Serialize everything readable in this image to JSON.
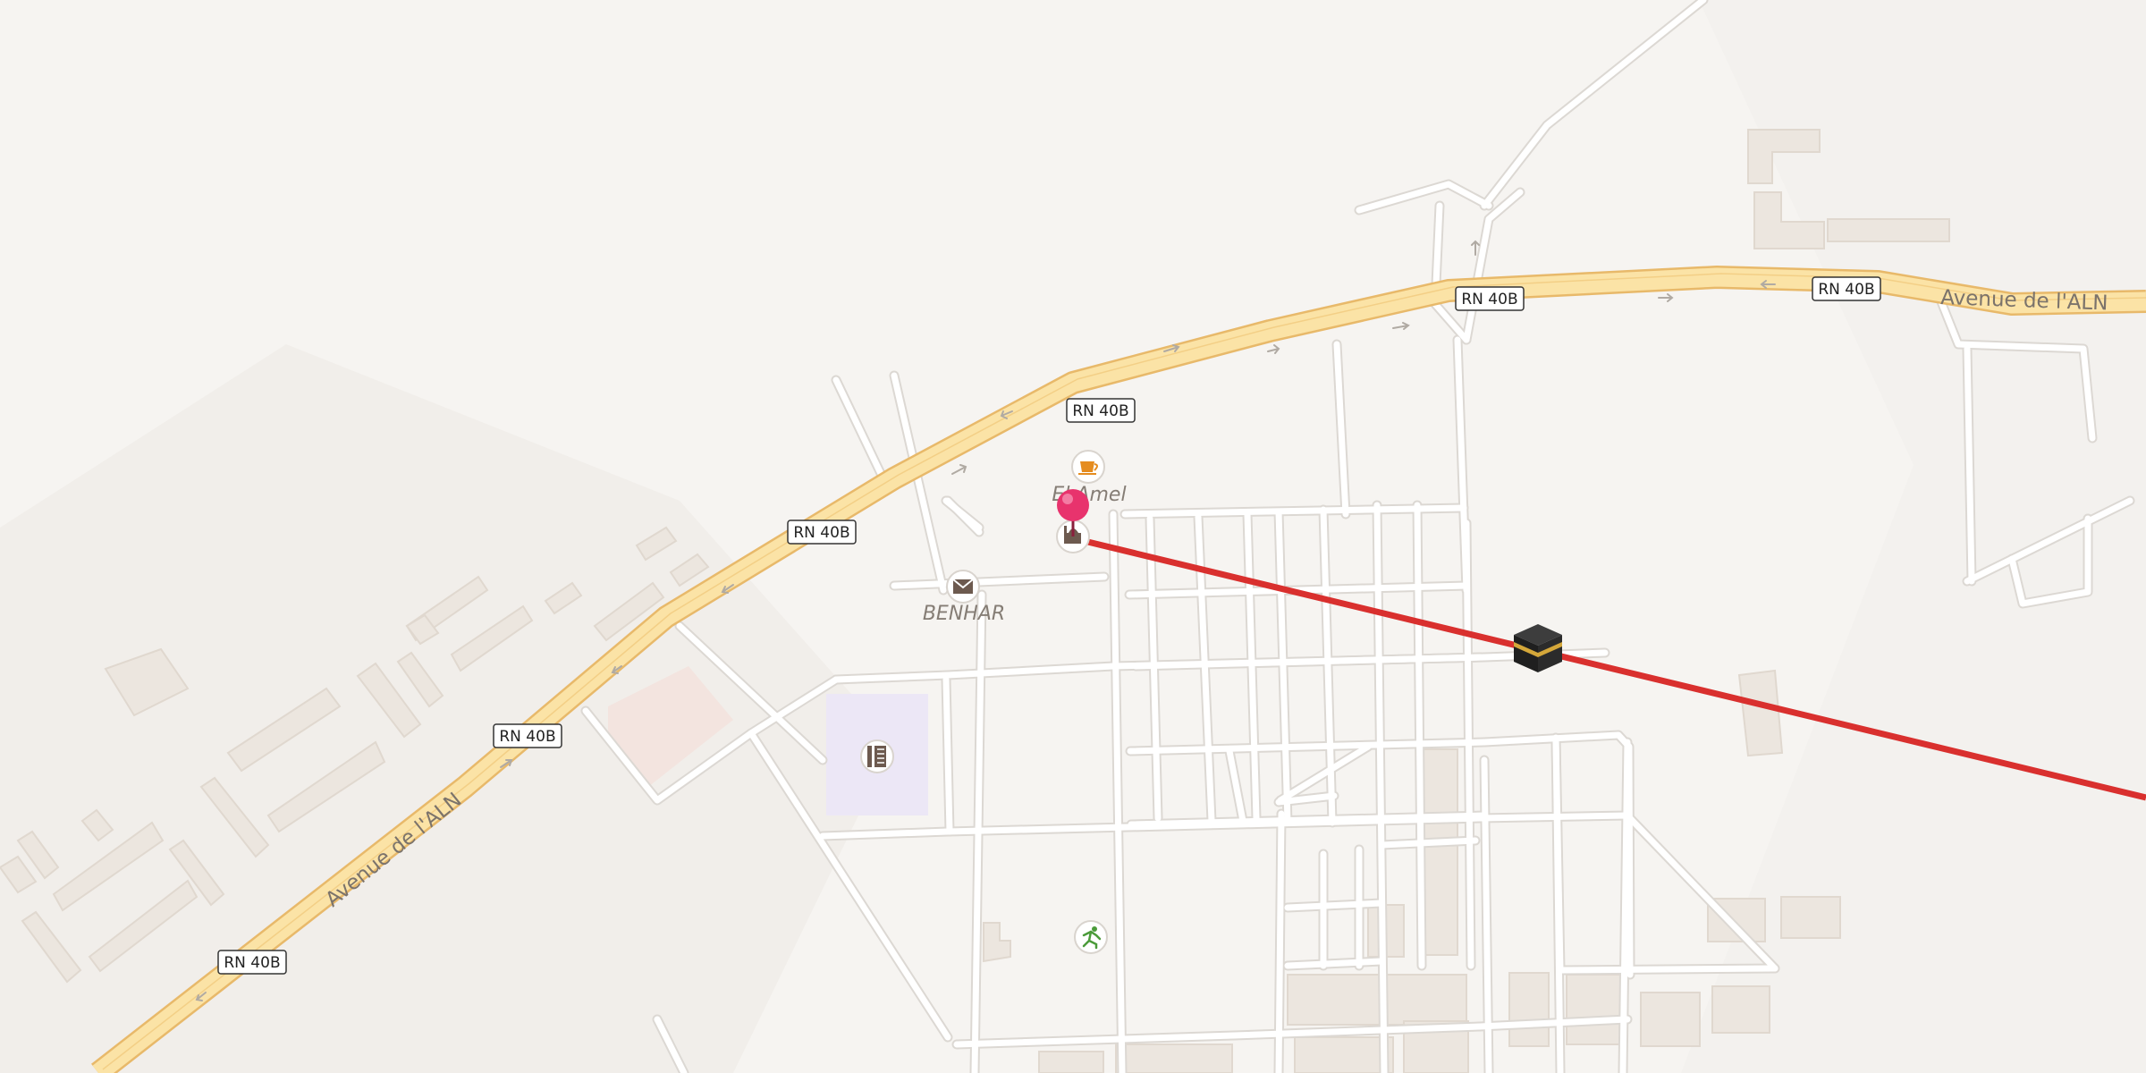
{
  "map": {
    "road_shields": [
      {
        "text": "RN 40B"
      },
      {
        "text": "RN 40B"
      },
      {
        "text": "RN 40B"
      },
      {
        "text": "RN 40B"
      },
      {
        "text": "RN 40B"
      },
      {
        "text": "RN 40B"
      }
    ],
    "street_labels": [
      {
        "text": "Avenue de l'ALN"
      },
      {
        "text": "Avenue de l'ALN"
      }
    ],
    "place_labels": [
      {
        "text": "BENHAR"
      },
      {
        "text": "El Amel"
      }
    ],
    "poi_icons": [
      "cafe-icon",
      "post-office-icon",
      "mosque-icon",
      "school-icon",
      "sports-icon",
      "kaaba-icon",
      "location-pin-icon"
    ],
    "colors": {
      "background": "#f6f4f1",
      "land_tint": "#f1eeea",
      "major_road_fill": "#fbe3a6",
      "major_road_casing": "#e8b96a",
      "minor_road": "#ffffff",
      "minor_road_casing": "#dcd8d3",
      "building": "#ece6df",
      "building_edge": "#e0d8cf",
      "qibla_line": "#d9302e",
      "pin": "#e8336d",
      "school_area": "#ece7f6",
      "land_patch": "#f3e4df"
    }
  }
}
